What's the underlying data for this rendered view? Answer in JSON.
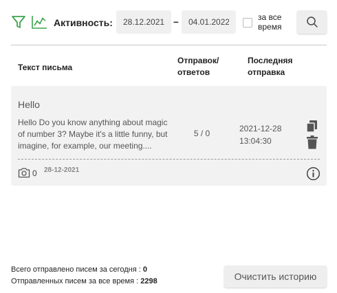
{
  "toolbar": {
    "filter_icon": "filter-icon",
    "chart_icon": "line-chart-icon",
    "activity_label": "Активность:",
    "date_from": "28.12.2021",
    "date_separator": "–",
    "date_to": "04.01.2022",
    "all_time_label": "за все время",
    "all_time_checked": false,
    "search_icon": "search-icon"
  },
  "colors": {
    "accent": "#3fa34d",
    "card_bg": "#f2f2f2",
    "button_bg": "#eeeeee"
  },
  "table": {
    "headers": {
      "text": "Текст письма",
      "sends": "Отправок/ ответов",
      "last": "Последняя отправка"
    },
    "rows": [
      {
        "subject": "Hello",
        "body": "Hello Do you know anything about magic of number 3? Maybe it's a little funny, but imagine, for example, our meeting....",
        "count": "5 / 0",
        "last_date": "2021-12-28",
        "last_time": "13:04:30",
        "attachments": "0",
        "created": "28-12-2021"
      }
    ]
  },
  "footer": {
    "sent_today_label": "Всего отправлено писем за сегодня :",
    "sent_today_value": "0",
    "sent_total_label": "Отправленных писем за все время :",
    "sent_total_value": "2298",
    "clear_button": "Очистить историю"
  }
}
